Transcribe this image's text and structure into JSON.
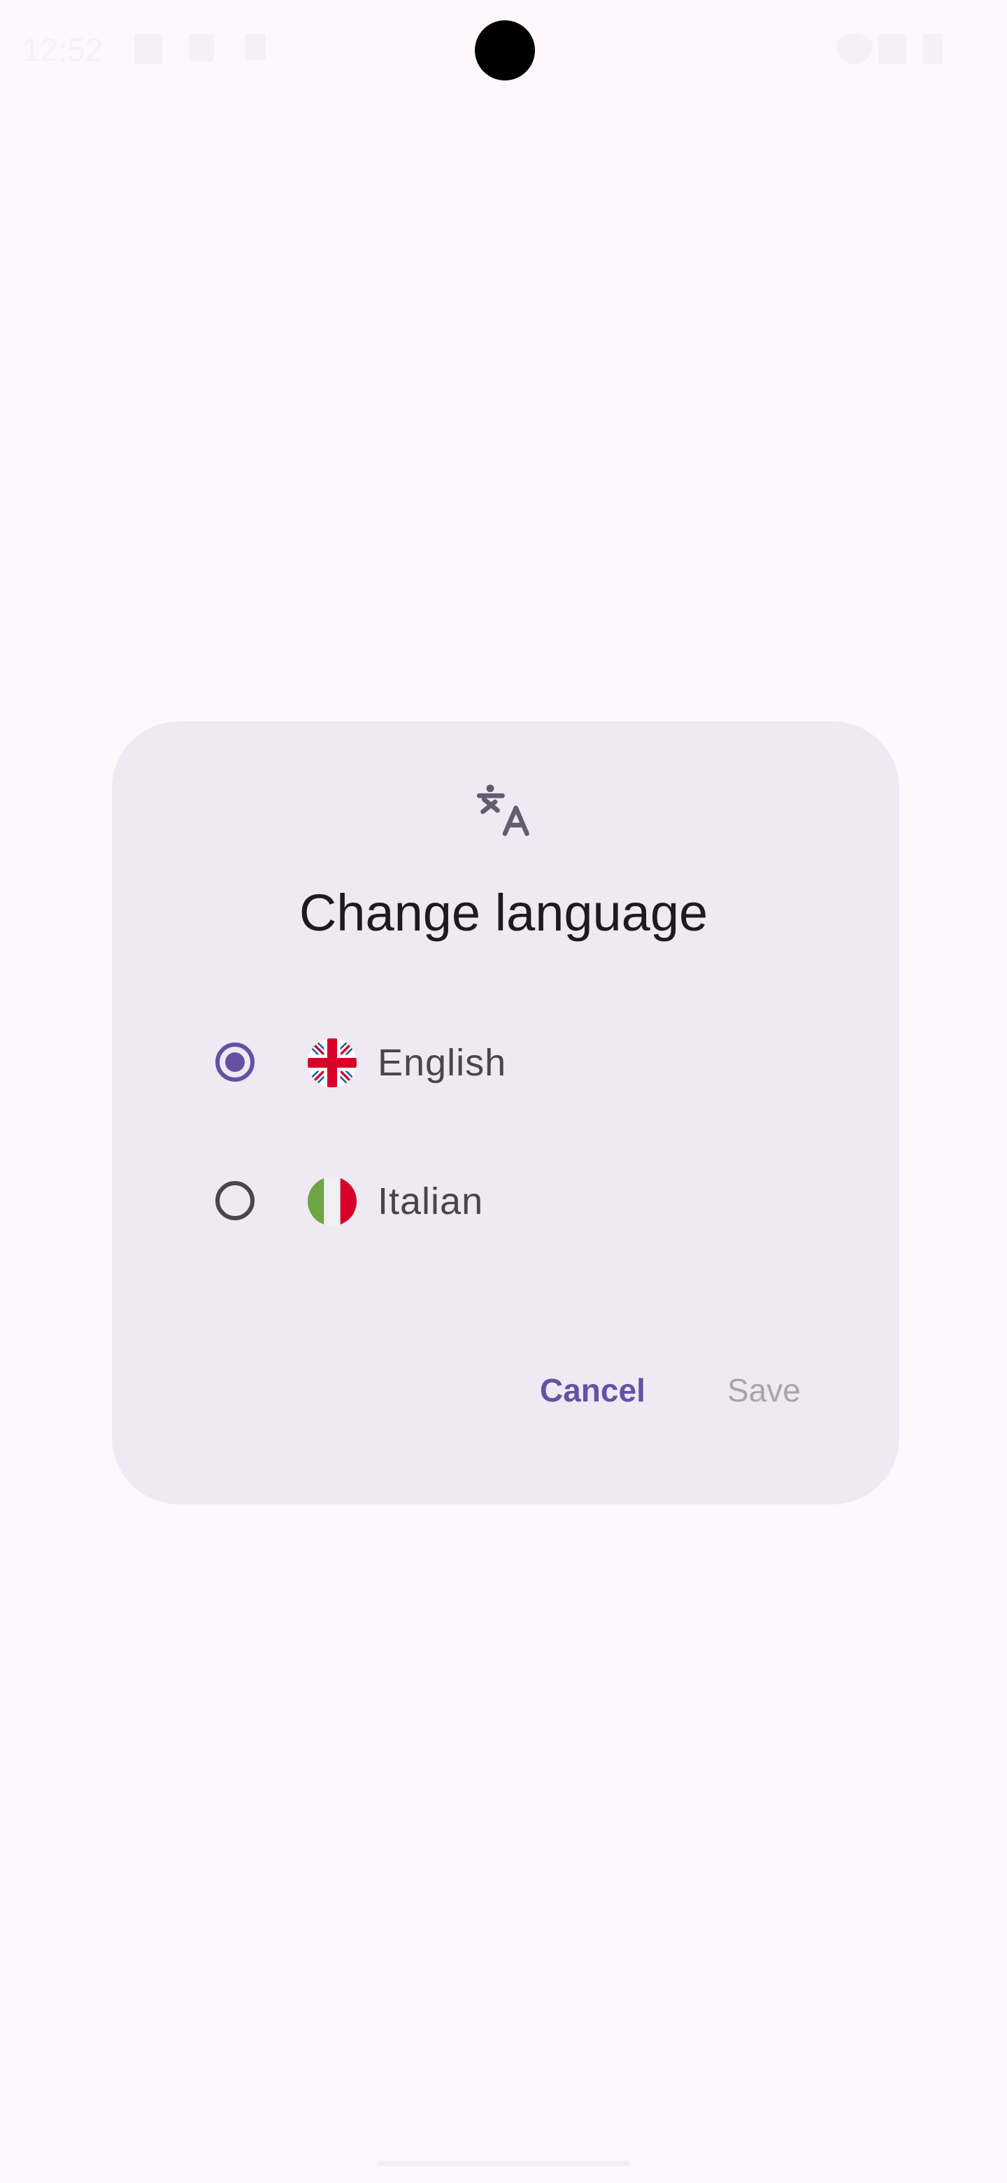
{
  "status_bar": {
    "time": "12:52"
  },
  "dialog": {
    "icon": "translate-icon",
    "title": "Change language",
    "options": [
      {
        "label": "English",
        "flag": "uk-flag-icon",
        "selected": true
      },
      {
        "label": "Italian",
        "flag": "italy-flag-icon",
        "selected": false
      }
    ],
    "cancel_label": "Cancel",
    "save_label": "Save"
  },
  "colors": {
    "primary": "#6750a4",
    "dialog_bg": "#eee9f2",
    "background": "#fef7fb"
  }
}
